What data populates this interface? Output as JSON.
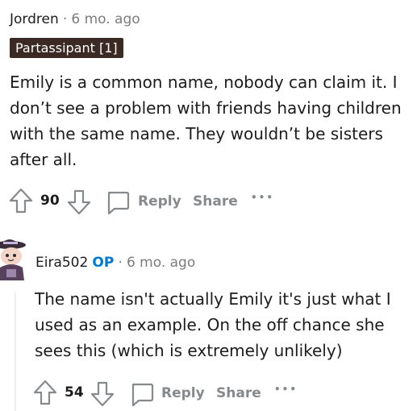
{
  "comment1": {
    "username": "Jordren",
    "separator": "·",
    "timestamp": "6 mo. ago",
    "flair": "Partassipant [1]",
    "body": [
      "Emily is a common name, nobody can claim it. I",
      "don’t see a problem with friends having children",
      "with the same name. They wouldn’t be sisters",
      "after all."
    ],
    "votes": "90",
    "reply_label": "Reply",
    "share_label": "Share",
    "more_label": "•••"
  },
  "comment2": {
    "username": "Eira502",
    "op_badge": "OP",
    "separator": "·",
    "timestamp": "6 mo. ago",
    "body": [
      "The name isn't actually Emily it's just what I",
      "used as an example. On the off chance she",
      "sees this (which is extremely unlikely)"
    ],
    "votes": "54",
    "reply_label": "Reply",
    "share_label": "Share",
    "more_label": "•••"
  },
  "icons": {
    "upvote": "upvote-arrow-icon",
    "downvote": "downvote-arrow-icon",
    "reply": "speech-bubble-icon",
    "avatar": "snoo-avatar"
  },
  "colors": {
    "flair_bg": "#3a2a23",
    "op_blue": "#0079d3",
    "muted": "#878a8c"
  }
}
